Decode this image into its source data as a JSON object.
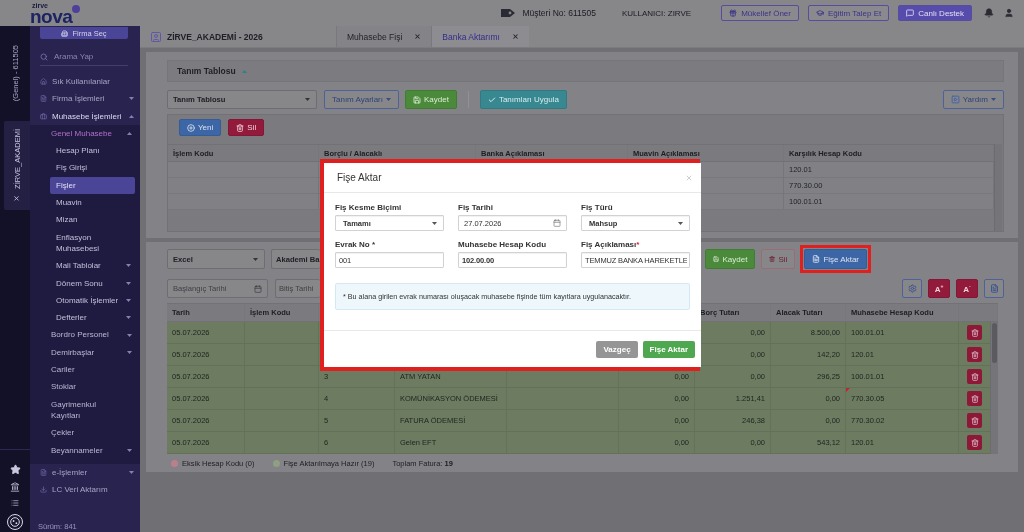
{
  "header": {
    "logo": {
      "brand": "zirve",
      "name": "nova"
    },
    "customer_no": "Müşteri No: 611505",
    "user": "KULLANICI: ZIRVE",
    "buttons": [
      {
        "label": "Mükellef Öner",
        "kind": "gift",
        "filled": false
      },
      {
        "label": "Eğitim Talep Et",
        "kind": "education",
        "filled": false
      },
      {
        "label": "Canlı Destek",
        "kind": "chat",
        "filled": true
      }
    ]
  },
  "rail": {
    "company_code": "(Genel) - 611505",
    "company_tab": "ZİRVE_AKADEMİ"
  },
  "sidebar": {
    "company_button": "Firma Seç",
    "search": {
      "placeholder": "Arama Yap"
    },
    "items": [
      {
        "label": "Sık Kullanılanlar",
        "selected": false
      },
      {
        "label": "Firma İşlemleri",
        "selected": false,
        "expanded": false
      },
      {
        "label": "Muhasebe İşlemleri",
        "selected": false,
        "expanded": true,
        "children": [
          {
            "label": "Genel Muhasebe",
            "selected": false,
            "expanded": true,
            "children": [
              {
                "label": "Hesap Planı",
                "selected": false
              },
              {
                "label": "Fiş Girişi",
                "selected": false
              },
              {
                "label": "Fişler",
                "selected": true
              },
              {
                "label": "Muavin",
                "selected": false
              },
              {
                "label": "Mizan",
                "selected": false
              },
              {
                "label": "Enflasyon Muhasebesi",
                "selected": false
              },
              {
                "label": "Mali Tablolar",
                "selected": false,
                "expanded": false
              },
              {
                "label": "Dönem Sonu",
                "selected": false,
                "expanded": false
              },
              {
                "label": "Otomatik İşlemler",
                "selected": false,
                "expanded": false
              },
              {
                "label": "Defterler",
                "selected": false,
                "expanded": false
              }
            ]
          },
          {
            "label": "Bordro Personel",
            "selected": false,
            "expanded": false
          },
          {
            "label": "Demirbaşlar",
            "selected": false,
            "expanded": false
          },
          {
            "label": "Cariler",
            "selected": false
          },
          {
            "label": "Stoklar",
            "selected": false
          },
          {
            "label": "Gayrimenkul Kayıtları",
            "selected": false
          },
          {
            "label": "Çekler",
            "selected": false
          },
          {
            "label": "Beyannameler",
            "selected": false,
            "expanded": false
          }
        ]
      },
      {
        "label": "e-İşlemler",
        "selected": false,
        "expanded": false
      },
      {
        "label": "LC Veri Aktarım",
        "selected": false
      }
    ],
    "version": "Sürüm: 841"
  },
  "tabs": {
    "company": "ZİRVE_AKADEMİ - 2026",
    "items": [
      {
        "label": "Muhasebe Fişi",
        "selected": false
      },
      {
        "label": "Banka Aktarımı",
        "selected": true
      }
    ]
  },
  "definition_panel": {
    "title": "Tanım Tablosu",
    "expanded": true,
    "table_select": "Tanım Tablosu",
    "settings_button": "Tanım Ayarları",
    "save_button": "Kaydet",
    "apply_button": "Tanımları Uygula",
    "help_button": "Yardım",
    "new_button": "Yeni",
    "delete_button": "Sil",
    "columns": [
      "İşlem Kodu",
      "Borçlu / Alacaklı",
      "Banka Açıklaması",
      "Muavin Açıklaması",
      "Karşılık Hesap Kodu"
    ],
    "rows": [
      [
        null,
        null,
        null,
        null,
        "120.01"
      ],
      [
        null,
        null,
        null,
        null,
        "770.30.00"
      ],
      [
        null,
        null,
        null,
        null,
        "100.01.01"
      ]
    ]
  },
  "transfer_panel": {
    "selects": [
      "Excel",
      "Akademi Ba"
    ],
    "save_button": {
      "label": "Kaydet",
      "disabled": false
    },
    "delete_button": {
      "label": "Sil",
      "disabled": true
    },
    "transfer_button": {
      "label": "Fişe Aktar",
      "highlighted": true
    },
    "date_fields": [
      {
        "placeholder": "Başlangıç Tarihi"
      },
      {
        "placeholder": "Bitiş Tarihi"
      }
    ],
    "tools": [
      {
        "kind": "settings"
      },
      {
        "kind": "font-up",
        "label": "A$^{+}$"
      },
      {
        "kind": "font-down",
        "label": "A$^{-}$"
      },
      {
        "kind": "file"
      }
    ],
    "columns": [
      "Tarih",
      "İşlem Kodu",
      null,
      null,
      null,
      null,
      "Borç Tutarı",
      "Alacak Tutarı",
      "Muhasebe Hesap Kodu"
    ],
    "rows": [
      {
        "ready": true,
        "flagged": false,
        "cells": [
          "05.07.2026",
          null,
          null,
          null,
          null,
          null,
          "0,00",
          "8.500,00",
          "100.01.01"
        ]
      },
      {
        "ready": true,
        "flagged": false,
        "cells": [
          "05.07.2026",
          null,
          null,
          null,
          null,
          null,
          "0,00",
          "142,20",
          "120.01"
        ]
      },
      {
        "ready": true,
        "flagged": false,
        "cells": [
          "05.07.2026",
          null,
          "3",
          "ATM YATAN",
          null,
          "0,00",
          "0,00",
          "296,25",
          "100.01.01"
        ]
      },
      {
        "ready": true,
        "flagged": true,
        "cells": [
          "05.07.2026",
          null,
          "4",
          "KOMÜNİKASYON ÖDEMESİ",
          null,
          "0,00",
          "1.251,41",
          "0,00",
          "770.30.05"
        ]
      },
      {
        "ready": true,
        "flagged": false,
        "cells": [
          "05.07.2026",
          null,
          "5",
          "FATURA ÖDEMESİ",
          null,
          "0,00",
          "246,38",
          "0,00",
          "770.30.02"
        ]
      },
      {
        "ready": true,
        "flagged": false,
        "cells": [
          "05.07.2026",
          null,
          "6",
          "Gelen EFT",
          null,
          "0,00",
          "0,00",
          "543,12",
          "120.01"
        ]
      }
    ],
    "legend": [
      {
        "label": "Eksik Hesap Kodu (0)",
        "color": "#b9808c"
      },
      {
        "label": "Fişe Aktarılmaya Hazır (19)",
        "color": "#8e9f82"
      }
    ],
    "total": "Toplam Fatura: **19**"
  },
  "dialog": {
    "highlighted": true,
    "title": "Fişe Aktar",
    "fields": [
      {
        "label": "Fiş Kesme Biçimi",
        "kind": "select",
        "value": "Tamamı"
      },
      {
        "label": "Fiş Tarihi",
        "kind": "date",
        "value": "27.07.2026"
      },
      {
        "label": "Fiş Türü",
        "kind": "select",
        "value": "Mahsup"
      },
      {
        "label": "Evrak No *",
        "kind": "text",
        "value": "001"
      },
      {
        "label": "Muhasebe Hesap Kodu",
        "kind": "code",
        "value": "102.00.00"
      },
      {
        "label": "Fiş Açıklaması",
        "required_mark": "*",
        "kind": "text",
        "value": "TEMMUZ BANKA HAREKETLE"
      }
    ],
    "note": "* Bu alana girilen evrak numarası oluşacak muhasebe fişinde tüm kayıtlara uygulanacaktır.",
    "buttons": [
      {
        "label": "Vazgeç",
        "kind": "cancel"
      },
      {
        "label": "Fişe Aktar",
        "kind": "confirm"
      }
    ]
  }
}
